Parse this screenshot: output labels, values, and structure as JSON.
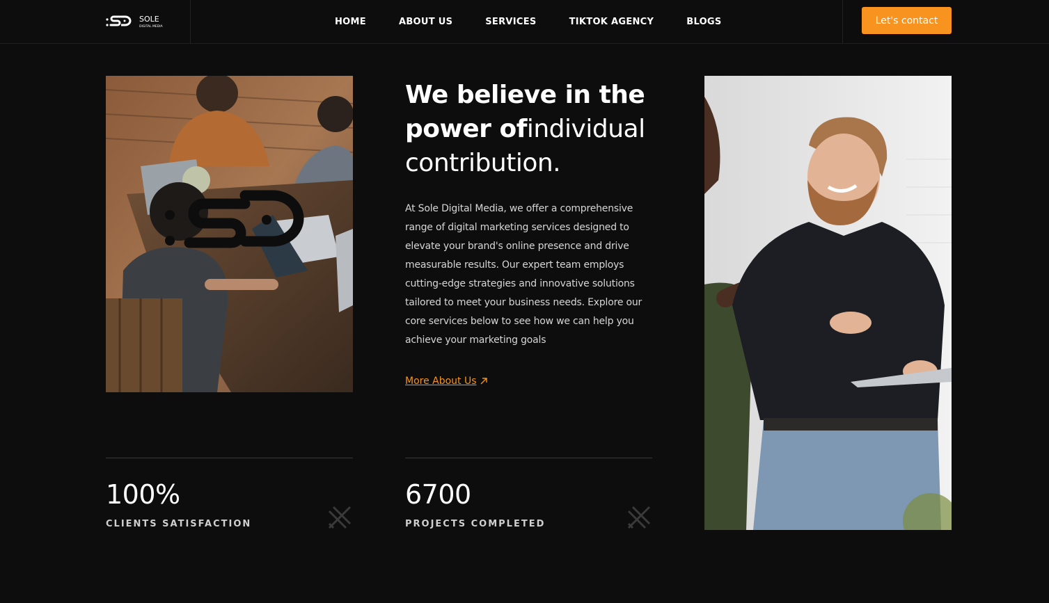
{
  "header": {
    "logo_text": "SOLE",
    "logo_subtext": "DIGITAL MEDIA",
    "nav": [
      {
        "label": "HOME"
      },
      {
        "label": "ABOUT US"
      },
      {
        "label": "SERVICES"
      },
      {
        "label": "TIKTOK AGENCY"
      },
      {
        "label": "BLOGS"
      }
    ],
    "cta_label": "Let's contact"
  },
  "main": {
    "headline_bold": "We believe in the power of",
    "headline_light": "individual contribution.",
    "body": "At Sole Digital Media, we offer a comprehensive range of digital marketing services designed to elevate your brand's online presence and drive measurable results. Our expert team employs cutting-edge strategies and innovative solutions tailored to meet your business needs. Explore our core services below to see how we can help you achieve your marketing goals",
    "more_link": "More About Us"
  },
  "stats": [
    {
      "value": "100%",
      "label": "CLIENTS SATISFACTION"
    },
    {
      "value": "6700",
      "label": "PROJECTS COMPLETED"
    }
  ],
  "colors": {
    "accent": "#f7931e",
    "background": "#0d0d0d"
  },
  "icons": {
    "link_arrow": "arrow-up-right-icon",
    "stat_icon": "pen-ruler-icon"
  }
}
